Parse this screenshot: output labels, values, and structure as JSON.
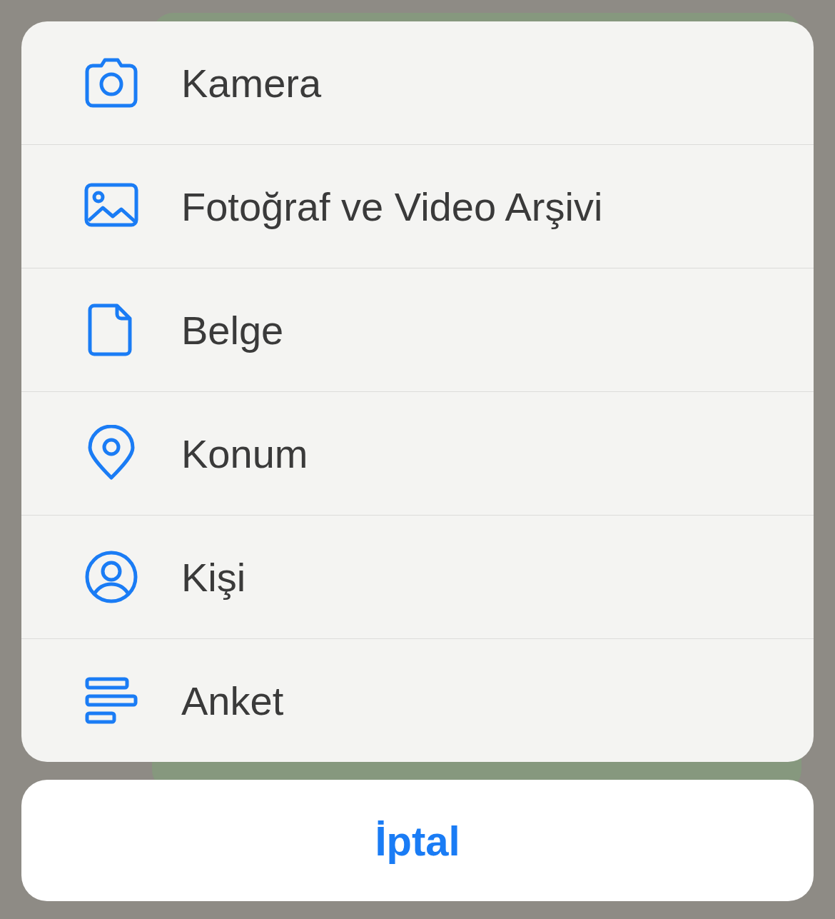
{
  "menu": {
    "items": [
      {
        "kind": "camera",
        "label": "Kamera"
      },
      {
        "kind": "photo",
        "label": "Fotoğraf ve Video Arşivi"
      },
      {
        "kind": "document",
        "label": "Belge"
      },
      {
        "kind": "location",
        "label": "Konum"
      },
      {
        "kind": "contact",
        "label": "Kişi"
      },
      {
        "kind": "poll",
        "label": "Anket"
      }
    ]
  },
  "cancel_button": {
    "label": "İptal"
  }
}
